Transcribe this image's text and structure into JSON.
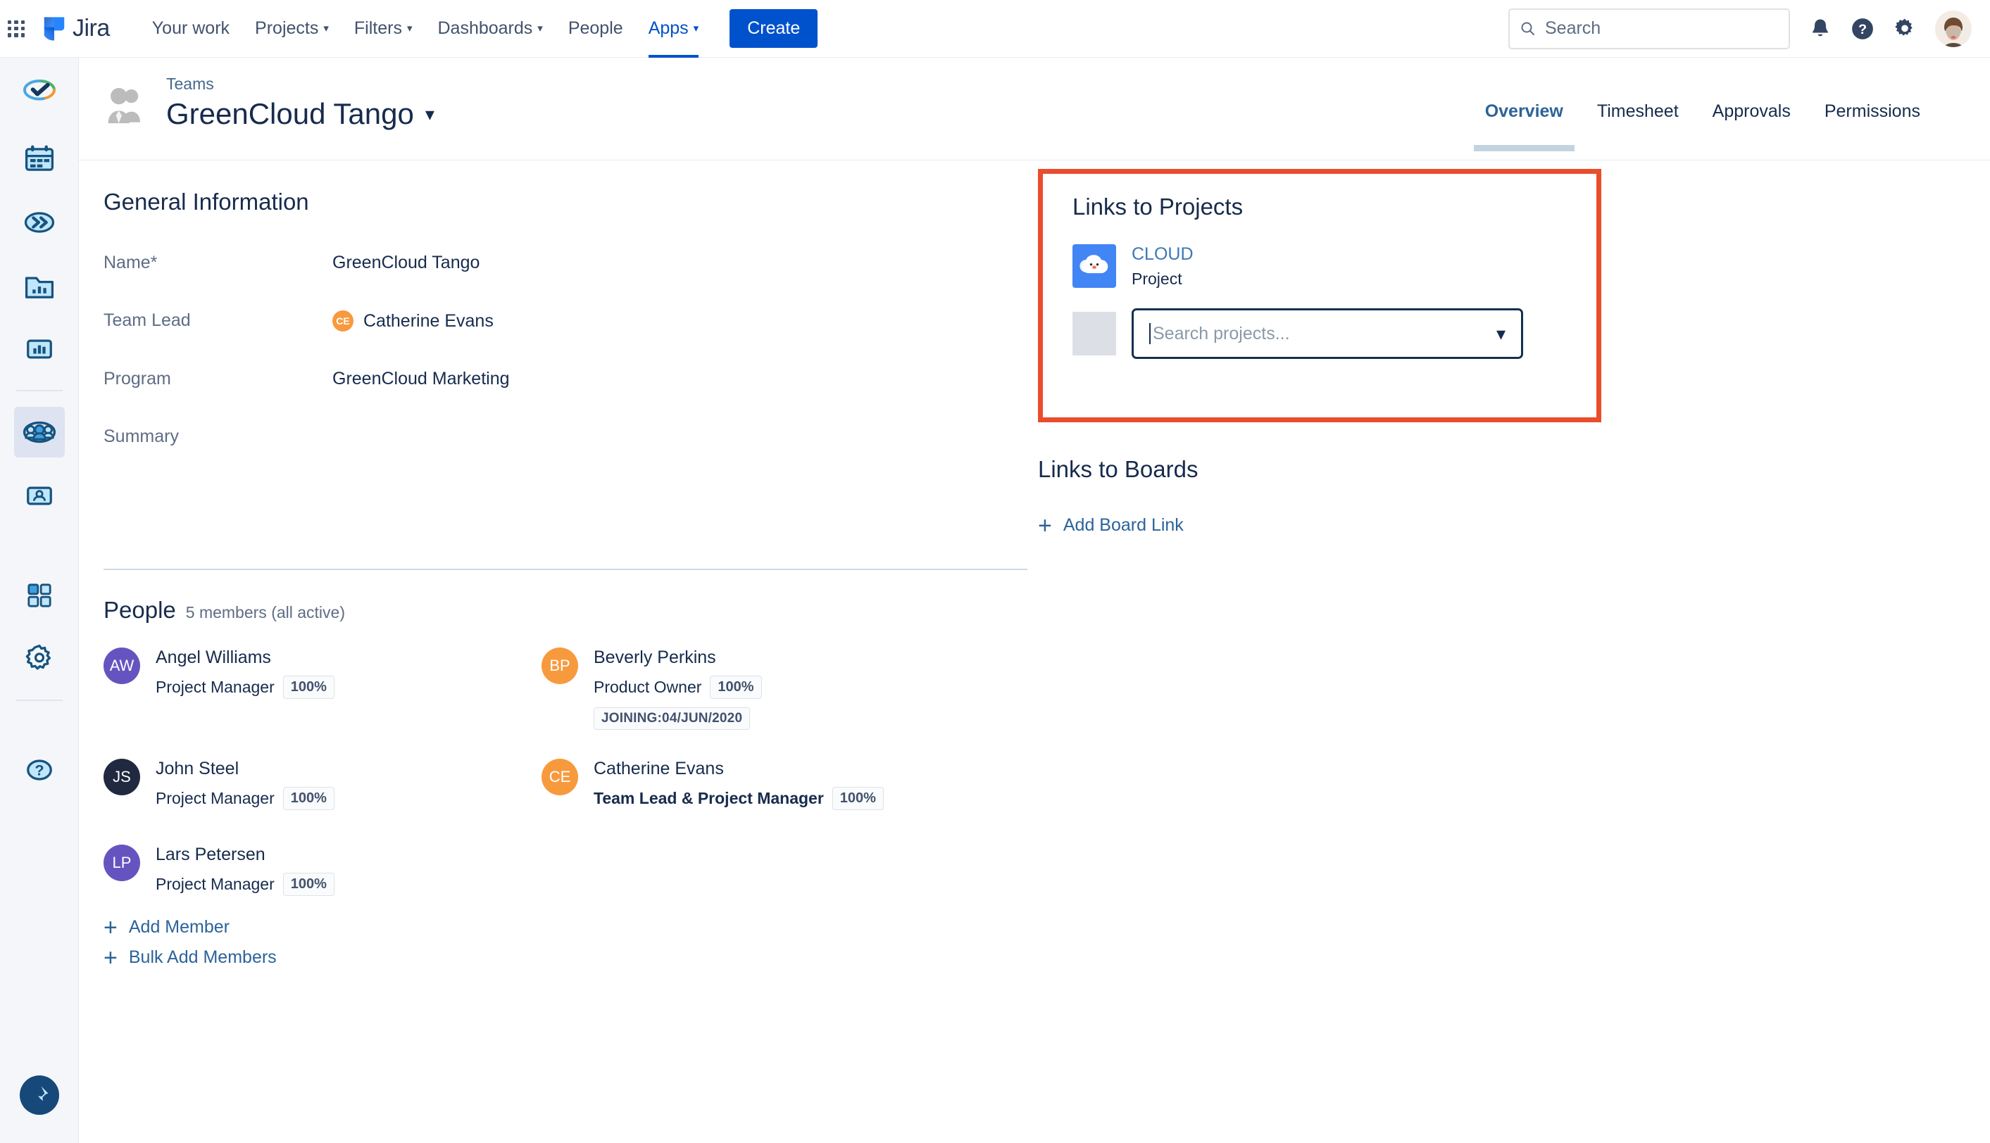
{
  "topnav": {
    "app_switcher": "app-switcher-icon",
    "logo_text": "Jira",
    "items": [
      {
        "label": "Your work",
        "has_caret": false,
        "active": false
      },
      {
        "label": "Projects",
        "has_caret": true,
        "active": false
      },
      {
        "label": "Filters",
        "has_caret": true,
        "active": false
      },
      {
        "label": "Dashboards",
        "has_caret": true,
        "active": false
      },
      {
        "label": "People",
        "has_caret": false,
        "active": false
      },
      {
        "label": "Apps",
        "has_caret": true,
        "active": true
      }
    ],
    "create_label": "Create",
    "search_placeholder": "Search",
    "icons": [
      "notifications-bell-icon",
      "help-icon",
      "settings-gear-icon",
      "user-avatar"
    ]
  },
  "sidebar": {
    "items": [
      {
        "name": "tempo-checkmark-icon",
        "selected": false
      },
      {
        "name": "calendar-icon",
        "selected": false
      },
      {
        "name": "fast-forward-icon",
        "selected": false
      },
      {
        "name": "folder-report-icon",
        "selected": false
      },
      {
        "name": "bar-chart-icon",
        "selected": false
      },
      {
        "name": "teams-icon",
        "selected": true
      },
      {
        "name": "person-card-icon",
        "selected": false
      },
      {
        "name": "apps-grid-icon",
        "selected": false
      },
      {
        "name": "settings-gear-icon",
        "selected": false
      },
      {
        "name": "help-circle-icon",
        "selected": false
      },
      {
        "name": "pin-icon",
        "selected": false
      }
    ]
  },
  "page_header": {
    "breadcrumb": "Teams",
    "title": "GreenCloud Tango",
    "tabs": [
      {
        "label": "Overview",
        "active": true
      },
      {
        "label": "Timesheet",
        "active": false
      },
      {
        "label": "Approvals",
        "active": false
      },
      {
        "label": "Permissions",
        "active": false
      }
    ]
  },
  "general_information": {
    "heading": "General Information",
    "fields": [
      {
        "label": "Name*",
        "value": "GreenCloud Tango",
        "avatar": null
      },
      {
        "label": "Team Lead",
        "value": "Catherine Evans",
        "avatar": {
          "initials": "CE",
          "color": "#f79a3e"
        }
      },
      {
        "label": "Program",
        "value": "GreenCloud Marketing",
        "avatar": null
      },
      {
        "label": "Summary",
        "value": "",
        "avatar": null
      }
    ]
  },
  "people": {
    "heading": "People",
    "count_text": "5 members (all active)",
    "members": [
      {
        "initials": "AW",
        "color": "#6554c0",
        "name": "Angel Williams",
        "role": "Project Manager",
        "allocation": "100%",
        "joining": null,
        "lead": false
      },
      {
        "initials": "BP",
        "color": "#f79a3e",
        "name": "Beverly Perkins",
        "role": "Product Owner",
        "allocation": "100%",
        "joining": "JOINING:04/JUN/2020",
        "lead": false
      },
      {
        "initials": "JS",
        "color": "#20293f",
        "name": "John Steel",
        "role": "Project Manager",
        "allocation": "100%",
        "joining": null,
        "lead": false
      },
      {
        "initials": "CE",
        "color": "#f79a3e",
        "name": "Catherine Evans",
        "role": "Team Lead & Project Manager",
        "allocation": "100%",
        "joining": null,
        "lead": true
      },
      {
        "initials": "LP",
        "color": "#6554c0",
        "name": "Lars Petersen",
        "role": "Project Manager",
        "allocation": "100%",
        "joining": null,
        "lead": false
      }
    ],
    "add_member_label": "Add Member",
    "bulk_add_label": "Bulk Add Members"
  },
  "links_to_projects": {
    "heading": "Links to Projects",
    "highlight_color": "#ea4d2c",
    "project": {
      "key": "CLOUD",
      "type": "Project",
      "icon_color": "#4285f4",
      "icon": "cloud-face-icon"
    },
    "search_placeholder": "Search projects..."
  },
  "links_to_boards": {
    "heading": "Links to Boards",
    "add_board_label": "Add Board Link"
  }
}
